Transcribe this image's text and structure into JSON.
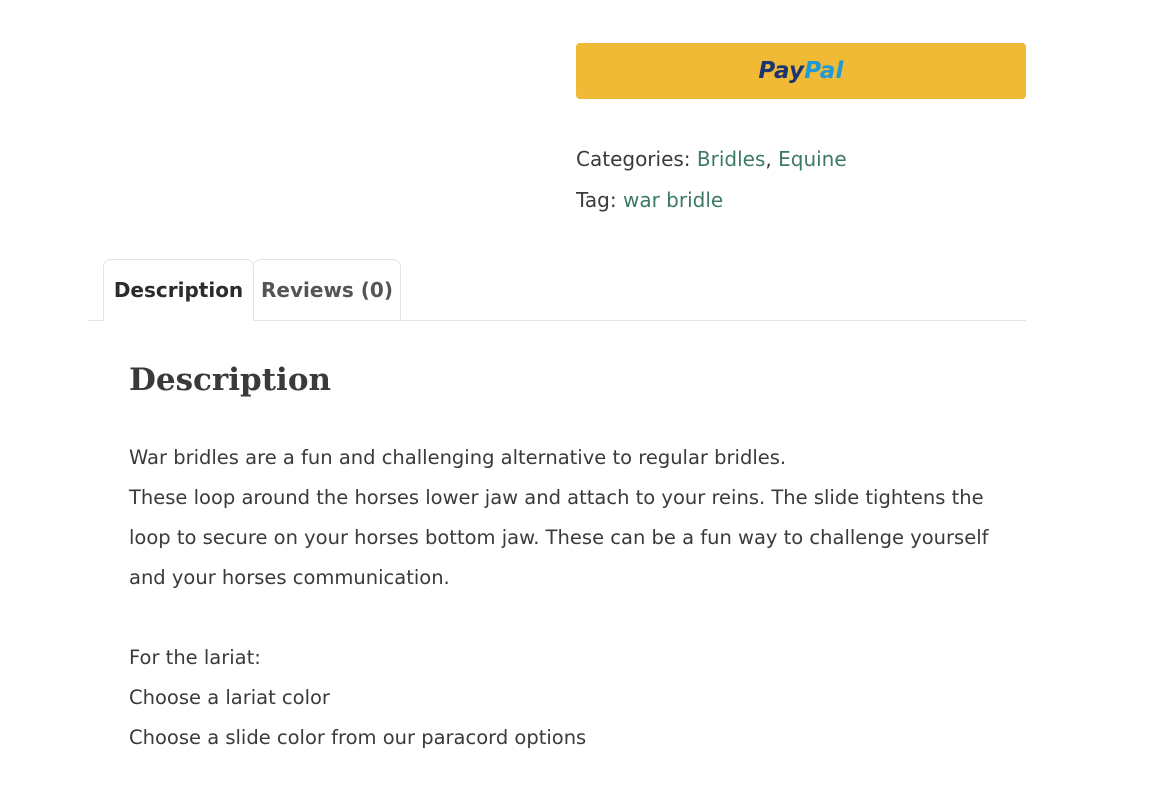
{
  "paypal": {
    "pay": "Pay",
    "pal": "Pal"
  },
  "meta": {
    "categories_label": "Categories:",
    "categories": [
      "Bridles",
      "Equine"
    ],
    "separator": ",",
    "tag_label": "Tag:",
    "tag": "war bridle"
  },
  "tabs": [
    {
      "label": "Description",
      "active": true
    },
    {
      "label": "Reviews (0)",
      "active": false
    }
  ],
  "description": {
    "heading": "Description",
    "paragraph1_line1": "War bridles are a fun and challenging alternative to regular bridles.",
    "paragraph1_rest": "These loop around the horses lower jaw and attach to your reins. The slide tightens the loop to secure on your horses bottom jaw. These can be a fun way to challenge yourself and your horses communication.",
    "lariat_heading": "For the lariat:",
    "lariat_items": [
      "Choose a lariat color",
      "Choose a slide color from our paracord options"
    ]
  },
  "colors": {
    "paypal_bg": "#f0b936",
    "paypal_pay": "#1b3572",
    "paypal_pal": "#1f9ad8",
    "link": "#3d7a66",
    "text": "#3a3a3a"
  }
}
